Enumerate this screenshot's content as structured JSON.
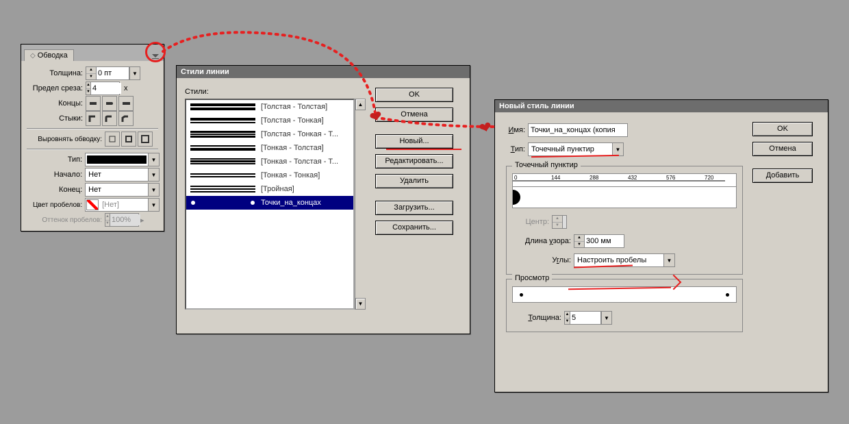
{
  "stroke_panel": {
    "tab_label": "Обводка",
    "weight_label": "Толщина:",
    "weight_value": "0 пт",
    "miter_label": "Предел среза:",
    "miter_value": "4",
    "miter_suffix": "x",
    "cap_label": "Концы:",
    "join_label": "Стыки:",
    "align_label": "Выровнять обводку:",
    "type_label": "Тип:",
    "start_label": "Начало:",
    "start_value": "Нет",
    "end_label": "Конец:",
    "end_value": "Нет",
    "gapcolor_label": "Цвет пробелов:",
    "gapcolor_value": "[Нет]",
    "gaptint_label": "Оттенок пробелов:",
    "gaptint_value": "100%"
  },
  "line_styles_dialog": {
    "title": "Стили линии",
    "styles_label": "Стили:",
    "items": [
      "[Толстая - Толстая]",
      "[Толстая - Тонкая]",
      "[Толстая - Тонкая - Т...",
      "[Тонкая - Толстая]",
      "[Тонкая - Толстая - Т...",
      "[Тонкая - Тонкая]",
      "[Тройная]",
      "Точки_на_концах"
    ],
    "btn_ok": "OK",
    "btn_cancel": "Отмена",
    "btn_new": "Новый...",
    "btn_edit": "Редактировать...",
    "btn_delete": "Удалить",
    "btn_load": "Загрузить...",
    "btn_save": "Сохранить..."
  },
  "new_style_dialog": {
    "title": "Новый стиль линии",
    "name_label": "Имя:",
    "name_value": "Точки_на_концах (копия",
    "type_label": "Тип:",
    "type_value": "Точечный пунктир",
    "group_label": "Точечный пунктир",
    "ruler_ticks": [
      "0",
      "144",
      "288",
      "432",
      "576",
      "720"
    ],
    "center_label": "Центр:",
    "pattern_len_label": "Длина узора:",
    "pattern_len_value": "300 мм",
    "corners_label": "Углы:",
    "corners_value": "Настроить пробелы",
    "preview_label": "Просмотр",
    "weight_label": "Толщина:",
    "weight_value": "5",
    "btn_ok": "OK",
    "btn_cancel": "Отмена",
    "btn_add": "Добавить"
  }
}
